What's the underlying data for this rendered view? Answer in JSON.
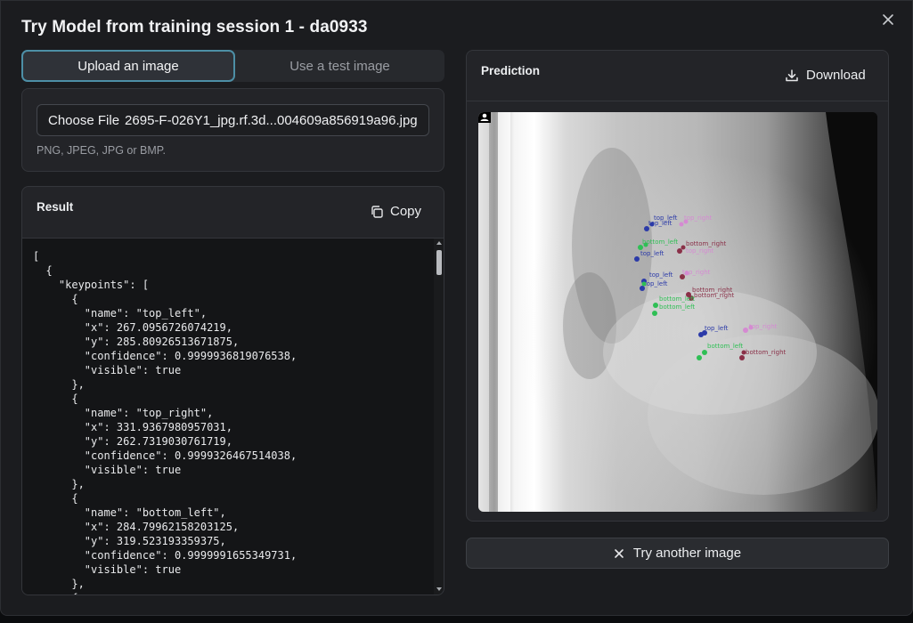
{
  "modal": {
    "title": "Try Model from training session 1 - da0933"
  },
  "tabs": [
    {
      "label": "Upload an image",
      "active": true
    },
    {
      "label": "Use a test image",
      "active": false
    }
  ],
  "upload": {
    "button_label": "Choose File",
    "file_name": "2695-F-026Y1_jpg.rf.3d...004609a856919a96.jpg",
    "hint": "PNG, JPEG, JPG or BMP."
  },
  "result": {
    "title": "Result",
    "copy_label": "Copy",
    "json_text": "[\n  {\n    \"keypoints\": [\n      {\n        \"name\": \"top_left\",\n        \"x\": 267.0956726074219,\n        \"y\": 285.80926513671875,\n        \"confidence\": 0.9999936819076538,\n        \"visible\": true\n      },\n      {\n        \"name\": \"top_right\",\n        \"x\": 331.9367980957031,\n        \"y\": 262.7319030761719,\n        \"confidence\": 0.9999326467514038,\n        \"visible\": true\n      },\n      {\n        \"name\": \"bottom_left\",\n        \"x\": 284.79962158203125,\n        \"y\": 319.523193359375,\n        \"confidence\": 0.9999991655349731,\n        \"visible\": true\n      },\n      {"
  },
  "prediction": {
    "title": "Prediction",
    "download_label": "Download",
    "keypoint_labels": {
      "top_left": "top_left",
      "top_right": "top_right",
      "bottom_left": "bottom_left",
      "bottom_right": "bottom_right"
    },
    "colors": {
      "top_left": "#2b3aa8",
      "top_right": "#d58ad2",
      "bottom_left": "#2fbf55",
      "bottom_right": "#8a3048"
    }
  },
  "actions": {
    "try_another_label": "Try another image"
  },
  "icons": {
    "close": "close-icon",
    "copy": "copy-icon",
    "download": "download-icon",
    "try_another": "x-icon",
    "person": "person-icon"
  }
}
